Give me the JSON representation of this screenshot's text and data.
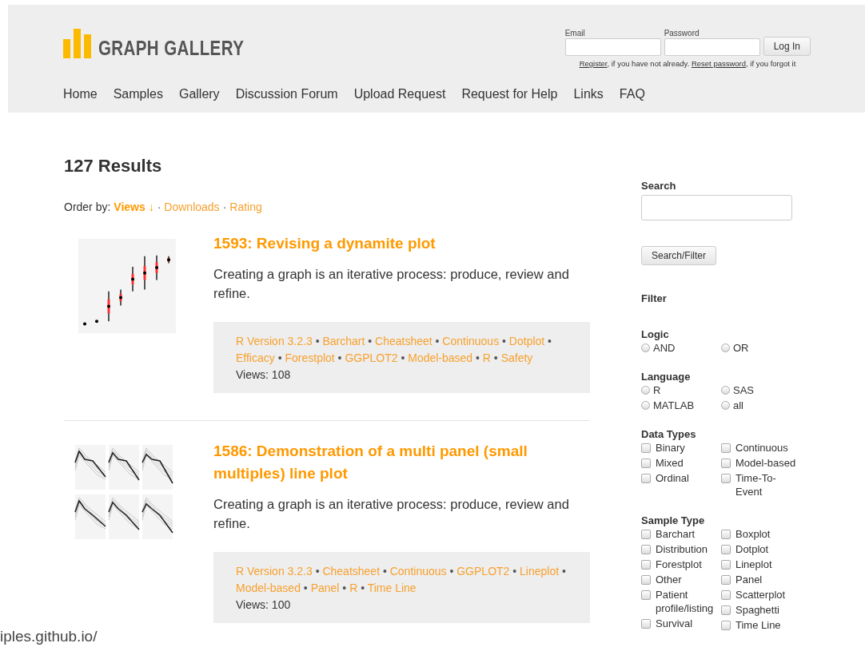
{
  "header": {
    "logo_text": "GRAPH GALLERY",
    "login": {
      "email_label": "Email",
      "password_label": "Password",
      "button": "Log In",
      "hint": [
        {
          "text": "Register",
          "link": true
        },
        {
          "text": ", if you have not already. ",
          "link": false
        },
        {
          "text": "Reset password",
          "link": true
        },
        {
          "text": ", if you forgot it",
          "link": false
        }
      ]
    },
    "nav": [
      "Home",
      "Samples",
      "Gallery",
      "Discussion Forum",
      "Upload Request",
      "Request for Help",
      "Links",
      "FAQ"
    ]
  },
  "results_heading": "127 Results",
  "order_by": {
    "label": "Order by:",
    "separator": "·",
    "options": [
      {
        "label": "Views ↓",
        "selected": true
      },
      {
        "label": "Downloads",
        "selected": false
      },
      {
        "label": "Rating",
        "selected": false
      }
    ]
  },
  "tag_separator": "•",
  "results": [
    {
      "title": "1593: Revising a dynamite plot",
      "description": "Creating a graph is an iterative process: produce, review and refine.",
      "tags": [
        "R Version 3.2.3",
        "Barchart",
        "Cheatsheet",
        "Continuous",
        "Dotplot",
        "Efficacy",
        "Forestplot",
        "GGPLOT2",
        "Model-based",
        "R",
        "Safety"
      ],
      "views": "Views: 108"
    },
    {
      "title": "1586: Demonstration of a multi panel (small multiples) line plot",
      "description": "Creating a graph is an iterative process: produce, review and refine.",
      "tags": [
        "R Version 3.2.3",
        "Cheatsheet",
        "Continuous",
        "GGPLOT2",
        "Lineplot",
        "Model-based",
        "Panel",
        "R",
        "Time Line"
      ],
      "views": "Views: 100"
    }
  ],
  "sidebar": {
    "search_label": "Search",
    "search_button": "Search/Filter",
    "filter_heading": "Filter",
    "groups": [
      {
        "title": "Logic",
        "kind": "radio",
        "columns": [
          [
            {
              "label": "AND",
              "checked": false
            }
          ],
          [
            {
              "label": "OR",
              "checked": false
            }
          ]
        ]
      },
      {
        "title": "Language",
        "kind": "radio",
        "columns": [
          [
            {
              "label": "R",
              "checked": false
            },
            {
              "label": "MATLAB",
              "checked": false
            }
          ],
          [
            {
              "label": "SAS",
              "checked": false
            },
            {
              "label": "all",
              "checked": false
            }
          ]
        ]
      },
      {
        "title": "Data Types",
        "kind": "checkbox",
        "columns": [
          [
            {
              "label": "Binary",
              "checked": false
            },
            {
              "label": "Mixed",
              "checked": false
            },
            {
              "label": "Ordinal",
              "checked": false
            }
          ],
          [
            {
              "label": "Continuous",
              "checked": false
            },
            {
              "label": "Model-based",
              "checked": false
            },
            {
              "label": "Time-To-Event",
              "checked": false
            }
          ]
        ]
      },
      {
        "title": "Sample Type",
        "kind": "checkbox",
        "columns": [
          [
            {
              "label": "Barchart",
              "checked": false
            },
            {
              "label": "Distribution",
              "checked": false
            },
            {
              "label": "Forestplot",
              "checked": false
            },
            {
              "label": "Other",
              "checked": false
            },
            {
              "label": "Patient profile/listing",
              "checked": false
            },
            {
              "label": "Survival",
              "checked": false
            }
          ],
          [
            {
              "label": "Boxplot",
              "checked": false
            },
            {
              "label": "Dotplot",
              "checked": false
            },
            {
              "label": "Lineplot",
              "checked": false
            },
            {
              "label": "Panel",
              "checked": false
            },
            {
              "label": "Scatterplot",
              "checked": false
            },
            {
              "label": "Spaghetti",
              "checked": false
            },
            {
              "label": "Time Line",
              "checked": false
            }
          ]
        ]
      }
    ]
  },
  "overlay_caption": "iples.github.io/"
}
